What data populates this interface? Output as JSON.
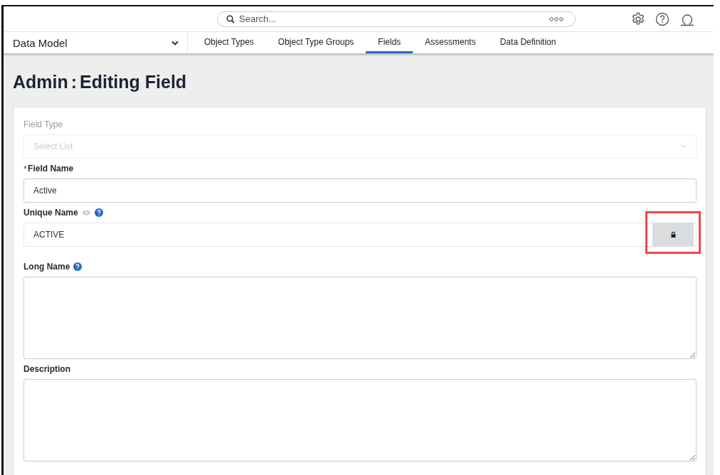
{
  "search": {
    "placeholder": "Search..."
  },
  "module": {
    "label": "Data Model"
  },
  "tabs": [
    {
      "label": "Object Types",
      "selected": false
    },
    {
      "label": "Object Type Groups",
      "selected": false
    },
    {
      "label": "Fields",
      "selected": true
    },
    {
      "label": "Assessments",
      "selected": false
    },
    {
      "label": "Data Definition",
      "selected": false
    }
  ],
  "title": {
    "prefix": "Admin",
    "separator": ":",
    "suffix": "Editing Field"
  },
  "fields": [
    {
      "kind": "select",
      "label": "Field Type",
      "placeholder": "Select List",
      "disabled": true,
      "eye": false,
      "help": false
    },
    {
      "kind": "text",
      "label": "Field Name",
      "required_mark": "*",
      "value": "Active",
      "disabled": false,
      "eye": false,
      "help": false
    },
    {
      "kind": "locked",
      "label": "Unique Name",
      "value": "ACTIVE",
      "disabled": false,
      "eye": true,
      "help": true,
      "highlighted": true
    },
    {
      "kind": "textarea",
      "label": "Long Name",
      "disabled": false,
      "eye": false,
      "help": true
    },
    {
      "kind": "textarea",
      "label": "Description",
      "disabled": false,
      "eye": false,
      "help": false
    }
  ]
}
